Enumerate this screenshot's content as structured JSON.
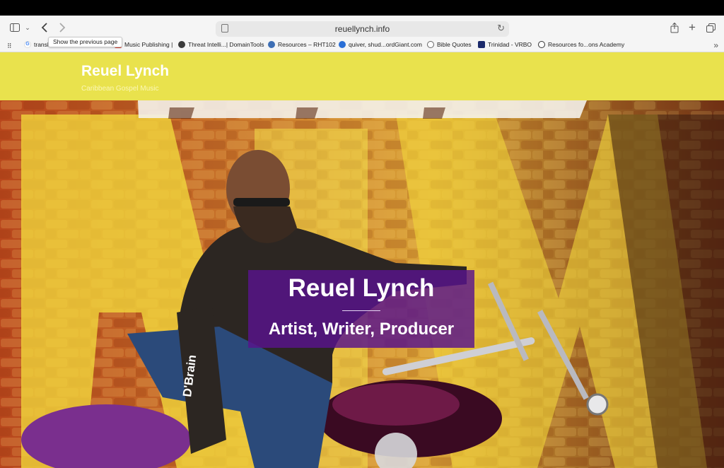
{
  "browser": {
    "url": "reuellynch.info",
    "tooltip": "Show the previous page",
    "bookmarks": [
      {
        "label": "translate Kamouraska Search",
        "icon": "google-icon"
      },
      {
        "label": "Music Publishing |",
        "icon": "music-icon"
      },
      {
        "label": "Threat Intelli...| DomainTools",
        "icon": "gear-icon"
      },
      {
        "label": "Resources – RHT102",
        "icon": "wordpress-icon"
      },
      {
        "label": "quiver, shud...ordGiant.com",
        "icon": "wordgiant-icon"
      },
      {
        "label": "Bible Quotes",
        "icon": "globe-icon"
      },
      {
        "label": "Trinidad - VRBO",
        "icon": "vrbo-icon"
      },
      {
        "label": "Resources fo...ons Academy",
        "icon": "academy-icon"
      }
    ]
  },
  "site": {
    "title": "Reuel Lynch",
    "tagline": "Caribbean Gospel Music"
  },
  "hero": {
    "title": "Reuel Lynch",
    "subtitle": "Artist, Writer, Producer",
    "sleeve_text": "D'Brain"
  },
  "colors": {
    "header_bg": "#e9e24d",
    "banner_bg": "#58148c"
  }
}
